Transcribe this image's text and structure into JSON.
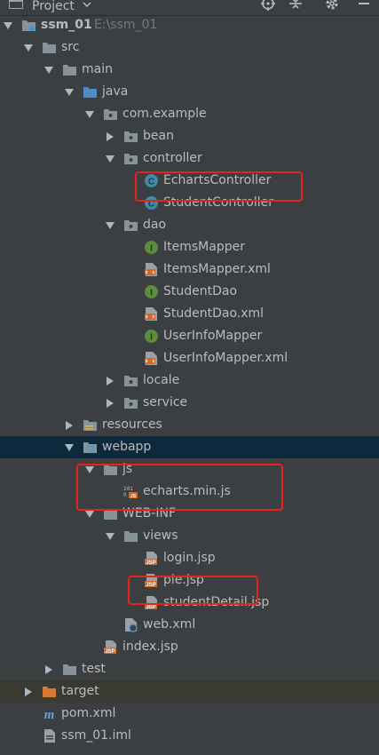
{
  "panel": {
    "title": "Project"
  },
  "colors": {
    "background": "#3c3f41",
    "selection": "#0d293e",
    "excluded": "#3b3a32",
    "highlight_box": "#e8221c",
    "folder": "#87939a",
    "class_icon": "#3d8ba6",
    "interface_icon": "#5a8e3a",
    "jsp_icon": "#d3692a"
  },
  "tree": [
    {
      "label": "ssm_01",
      "path": "E:\\ssm_01",
      "icon": "module-folder-icon",
      "state": "expanded"
    },
    {
      "label": "src",
      "icon": "folder-icon",
      "state": "expanded"
    },
    {
      "label": "main",
      "icon": "folder-icon",
      "state": "expanded"
    },
    {
      "label": "java",
      "icon": "source-folder-icon",
      "state": "expanded"
    },
    {
      "label": "com.example",
      "icon": "package-icon",
      "state": "expanded"
    },
    {
      "label": "bean",
      "icon": "package-icon",
      "state": "collapsed"
    },
    {
      "label": "controller",
      "icon": "package-icon",
      "state": "expanded"
    },
    {
      "label": "EchartsController",
      "icon": "class-icon",
      "state": "leaf",
      "highlighted": true
    },
    {
      "label": "StudentController",
      "icon": "class-icon",
      "state": "leaf"
    },
    {
      "label": "dao",
      "icon": "package-icon",
      "state": "expanded"
    },
    {
      "label": "ItemsMapper",
      "icon": "interface-icon",
      "state": "leaf"
    },
    {
      "label": "ItemsMapper.xml",
      "icon": "xml-file-icon",
      "state": "leaf"
    },
    {
      "label": "StudentDao",
      "icon": "interface-icon",
      "state": "leaf"
    },
    {
      "label": "StudentDao.xml",
      "icon": "xml-file-icon",
      "state": "leaf"
    },
    {
      "label": "UserInfoMapper",
      "icon": "interface-icon",
      "state": "leaf"
    },
    {
      "label": "UserInfoMapper.xml",
      "icon": "xml-file-icon",
      "state": "leaf"
    },
    {
      "label": "locale",
      "icon": "package-icon",
      "state": "collapsed"
    },
    {
      "label": "service",
      "icon": "package-icon",
      "state": "collapsed"
    },
    {
      "label": "resources",
      "icon": "resources-folder-icon",
      "state": "collapsed"
    },
    {
      "label": "webapp",
      "icon": "web-folder-icon",
      "state": "expanded",
      "selected": true
    },
    {
      "label": "js",
      "icon": "folder-icon",
      "state": "expanded",
      "highlighted": true
    },
    {
      "label": "echarts.min.js",
      "icon": "js-file-icon",
      "state": "leaf",
      "highlighted": true
    },
    {
      "label": "WEB-INF",
      "icon": "folder-icon",
      "state": "expanded"
    },
    {
      "label": "views",
      "icon": "folder-icon",
      "state": "expanded"
    },
    {
      "label": "login.jsp",
      "icon": "jsp-file-icon",
      "state": "leaf"
    },
    {
      "label": "pie.jsp",
      "icon": "jsp-file-icon",
      "state": "leaf",
      "highlighted": true
    },
    {
      "label": "studentDetail.jsp",
      "icon": "jsp-file-icon",
      "state": "leaf"
    },
    {
      "label": "web.xml",
      "icon": "web-xml-icon",
      "state": "leaf"
    },
    {
      "label": "index.jsp",
      "icon": "jsp-file-icon",
      "state": "leaf"
    },
    {
      "label": "test",
      "icon": "folder-icon",
      "state": "collapsed"
    },
    {
      "label": "target",
      "icon": "excluded-folder-icon",
      "state": "collapsed",
      "excluded": true
    },
    {
      "label": "pom.xml",
      "icon": "maven-icon",
      "state": "leaf"
    },
    {
      "label": "ssm_01.iml",
      "icon": "iml-file-icon",
      "state": "leaf"
    }
  ]
}
